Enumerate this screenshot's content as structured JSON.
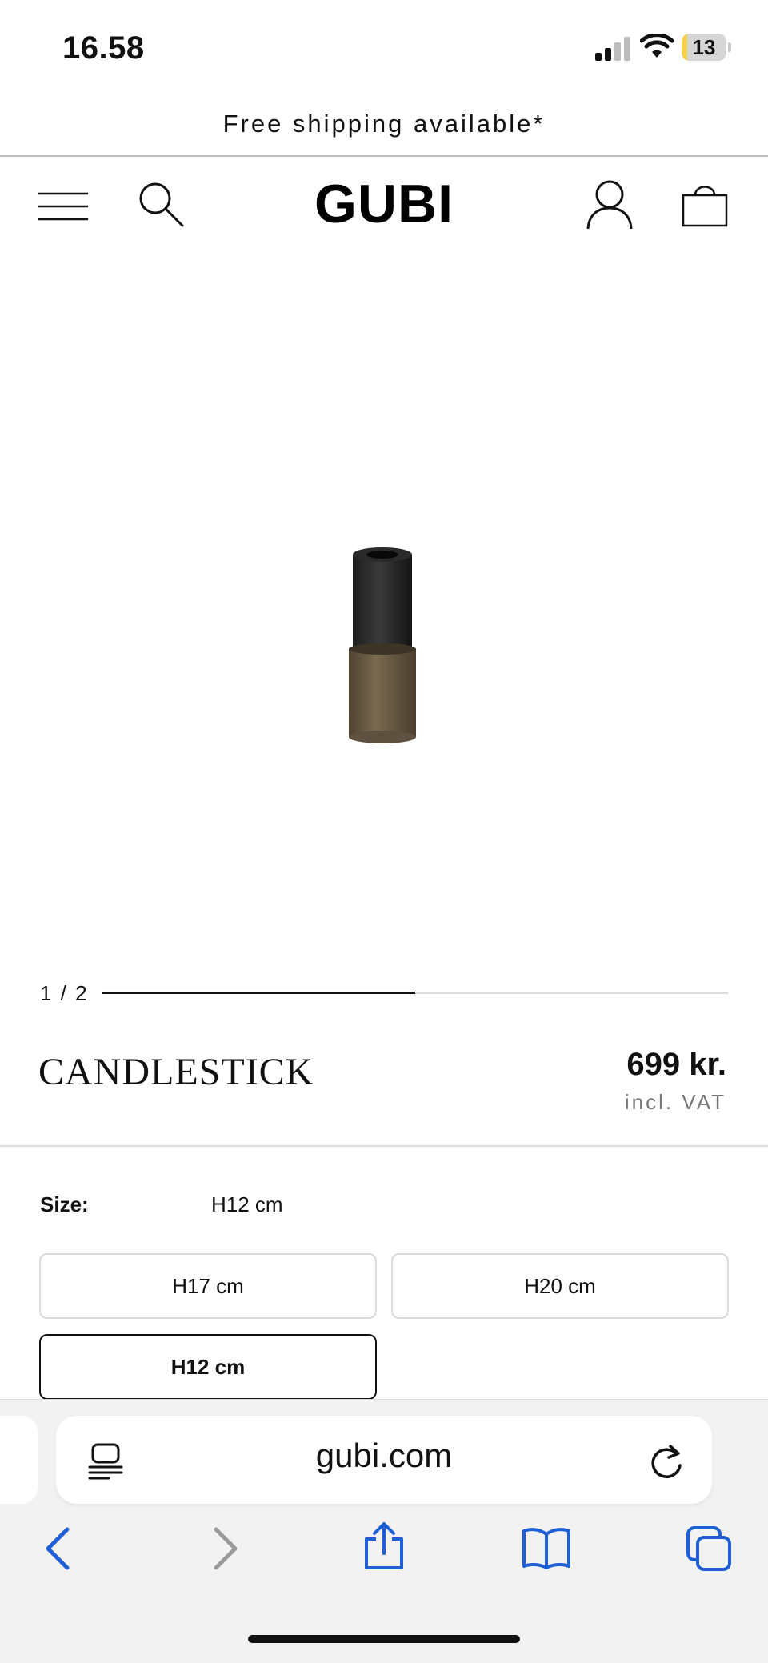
{
  "status_bar": {
    "time": "16.58",
    "battery_level": "13",
    "battery_fraction": 0.13,
    "battery_color": "#f2d24a",
    "icons": [
      "cellular-signal-icon",
      "wifi-icon",
      "battery-icon"
    ]
  },
  "announcement": {
    "text": "Free shipping available*"
  },
  "header": {
    "logo": "GUBI",
    "icons": [
      "menu-icon",
      "search-icon",
      "account-icon",
      "shopping-bag-icon"
    ]
  },
  "product": {
    "image_description_icon": "candlestick-image",
    "carousel": {
      "counter": "1 / 2",
      "current": 1,
      "total": 2,
      "progress_fraction": 0.5
    },
    "title": "CANDLESTICK",
    "price": "699 kr.",
    "price_note": "incl. VAT",
    "size": {
      "label": "Size:",
      "selected_value": "H12 cm",
      "options": [
        {
          "label": "H17 cm",
          "selected": false
        },
        {
          "label": "H20 cm",
          "selected": false
        },
        {
          "label": "H12 cm",
          "selected": true
        }
      ]
    }
  },
  "browser": {
    "url": "gubi.com",
    "icons": [
      "reader-mode-icon",
      "reload-icon",
      "back-icon",
      "forward-icon",
      "share-icon",
      "bookmarks-icon",
      "tabs-icon"
    ],
    "accent_color": "#1f5fd6",
    "disabled_color": "#9a9a9a"
  }
}
